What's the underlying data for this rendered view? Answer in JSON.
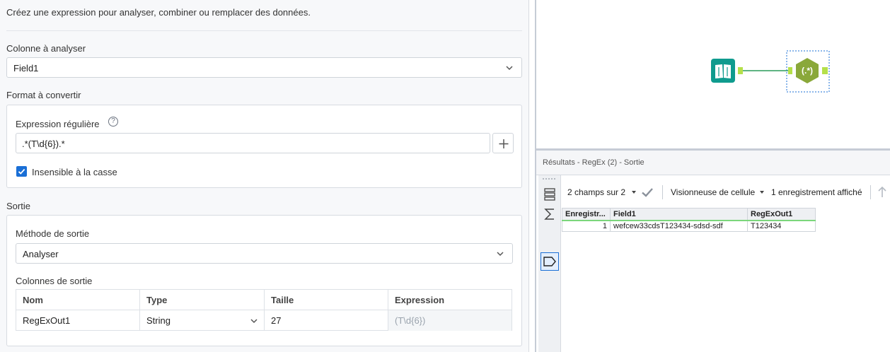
{
  "config": {
    "description": "Créez une expression pour analyser, combiner ou remplacer des données.",
    "column_to_parse": {
      "label": "Colonne à analyser",
      "value": "Field1"
    },
    "format_section": {
      "label": "Format à convertir",
      "regex_label": "Expression régulière",
      "regex_value": ".*(T\\d{6}).*",
      "case_insensitive_label": "Insensible à la casse",
      "case_insensitive": true
    },
    "output_section": {
      "label": "Sortie",
      "method_label": "Méthode de sortie",
      "method_value": "Analyser",
      "columns_label": "Colonnes de sortie",
      "table_headers": [
        "Nom",
        "Type",
        "Taille",
        "Expression"
      ],
      "rows": [
        {
          "name": "RegExOut1",
          "type": "String",
          "size": "27",
          "expression": "(T\\d{6})"
        }
      ]
    }
  },
  "results": {
    "title": "Résultats - RegEx (2) - Sortie",
    "fields_label": "2 champs sur 2",
    "viewer_label": "Visionneuse de cellule",
    "records_label": "1 enregistrement affiché",
    "table": {
      "headers": [
        "Enregistr...",
        "Field1",
        "RegExOut1"
      ],
      "rows": [
        {
          "record": "1",
          "field1": "wefcew33cdsT123434-sdsd-sdf",
          "regexout1": "T123434"
        }
      ]
    }
  },
  "workflow": {
    "input_tool_icon": "book-icon",
    "regex_tool_label": "(.*)",
    "colors": {
      "input_tool": "#0f9b8e",
      "regex_tool": "#8aa83a",
      "connection": "#2a9b5a",
      "anchor": "#b5e04a",
      "accent": "#1a6fd6"
    }
  }
}
